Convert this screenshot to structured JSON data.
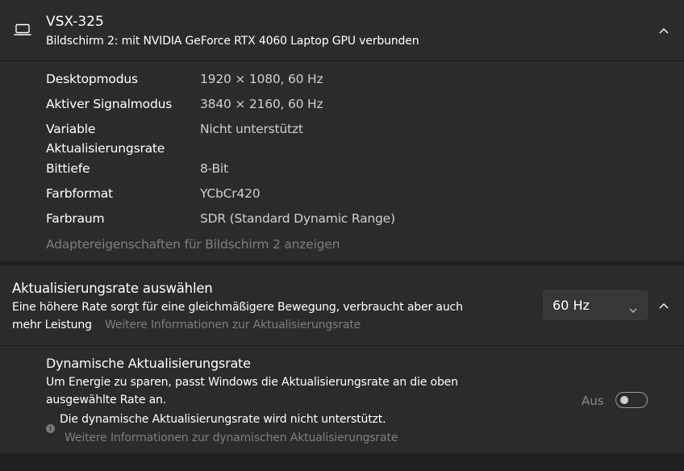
{
  "display": {
    "name": "VSX-325",
    "subtitle": "Bildschirm 2: mit NVIDIA GeForce RTX 4060 Laptop GPU verbunden",
    "icon": "laptop-icon",
    "expand_icon": "chevron-up-icon"
  },
  "properties": [
    {
      "label": "Desktopmodus",
      "value": "1920 × 1080, 60 Hz"
    },
    {
      "label": "Aktiver Signalmodus",
      "value": "3840 × 2160, 60 Hz"
    },
    {
      "label": "Variable",
      "label_line2": "Aktualisierungsrate",
      "value": "Nicht unterstützt"
    },
    {
      "label": "Bittiefe",
      "value": "8-Bit"
    },
    {
      "label": "Farbformat",
      "value": "YCbCr420"
    },
    {
      "label": "Farbraum",
      "value": "SDR (Standard Dynamic Range)"
    }
  ],
  "adapter_link": "Adaptereigenschaften für Bildschirm 2 anzeigen",
  "refresh": {
    "title": "Aktualisierungsrate auswählen",
    "desc_line1": "Eine höhere Rate sorgt für eine gleichmäßigere Bewegung, verbraucht aber auch",
    "desc_line2": "mehr Leistung",
    "more_link": "Weitere Informationen zur Aktualisierungsrate",
    "selected": "60 Hz"
  },
  "dynamic": {
    "title": "Dynamische Aktualisierungsrate",
    "desc_line1": "Um Energie zu sparen, passt Windows die Aktualisierungsrate an die oben",
    "desc_line2": "ausgewählte Rate an.",
    "warning": "Die dynamische Aktualisierungsrate wird nicht unterstützt.",
    "more_link": "Weitere Informationen zur dynamischen Aktualisierungsrate",
    "toggle_label": "Aus",
    "toggle_on": false
  }
}
